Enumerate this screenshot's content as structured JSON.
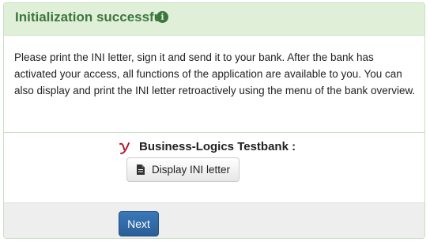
{
  "panel": {
    "title": "Initialization successful",
    "title_icon": "info-circle-icon",
    "message": "Please print the INI letter, sign it and send it to your bank. After the bank has activated your access, all functions of the application are available to you. You can also display and print the INI letter retroactively using the menu of the bank overview."
  },
  "bank": {
    "logo_icon": "bank-logo-icon",
    "name": "Business-Logics Testbank :",
    "display_button": {
      "icon": "document-icon",
      "label": "Display INI letter"
    }
  },
  "footer": {
    "next_label": "Next"
  },
  "colors": {
    "header_bg": "#e0f0d8",
    "title_color": "#3c763d",
    "primary_button": "#2f6aa8",
    "logo_red": "#b01a2e"
  }
}
